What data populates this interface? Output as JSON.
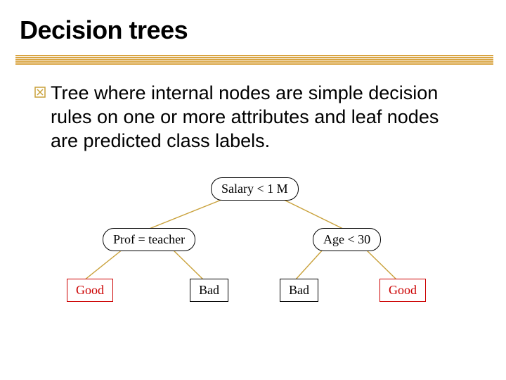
{
  "title": "Decision trees",
  "bullet": {
    "text": "Tree where internal nodes are simple decision rules on one or more attributes and leaf nodes are predicted class labels."
  },
  "tree": {
    "root": "Salary < 1 M",
    "left": "Prof = teacher",
    "right": "Age < 30",
    "leaves": {
      "l1": "Good",
      "l2": "Bad",
      "l3": "Bad",
      "l4": "Good"
    }
  }
}
